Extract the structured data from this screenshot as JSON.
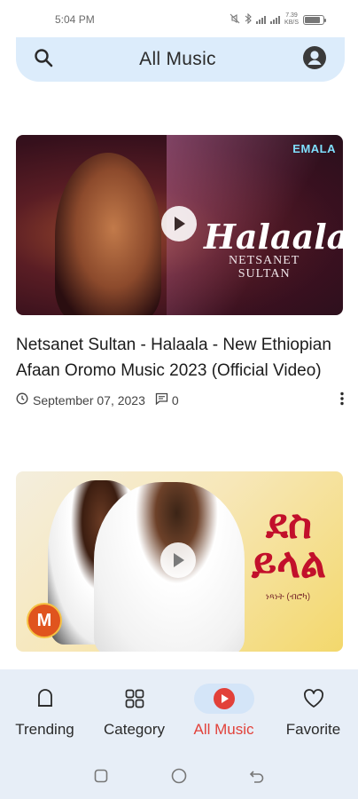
{
  "status": {
    "time": "5:04 PM",
    "speed_value": "7.39",
    "speed_unit": "KB/S",
    "battery_level": 0.9
  },
  "search": {
    "title": "All Music"
  },
  "videos": [
    {
      "overlay_title": "Halaala",
      "overlay_artist_line1": "NETSANET",
      "overlay_artist_line2": "SULTAN",
      "brand_logo": "EMALA",
      "title": "Netsanet Sultan - Halaala - New Ethiopian Afaan Oromo Music 2023 (Official Video)",
      "date": "September 07, 2023",
      "comments": "0"
    },
    {
      "overlay_title_line1": "ደስ",
      "overlay_title_line2": "ይላል",
      "overlay_subtitle": "ነጻነት (ብሮካ)",
      "channel_logo": "M"
    }
  ],
  "bottom_nav": {
    "items": [
      {
        "label": "Trending",
        "icon": "trending-icon"
      },
      {
        "label": "Category",
        "icon": "category-icon"
      },
      {
        "label": "All Music",
        "icon": "play-circle-icon"
      },
      {
        "label": "Favorite",
        "icon": "heart-icon"
      }
    ],
    "active_index": 2
  },
  "colors": {
    "accent": "#e2413a",
    "search_bg": "#dcecfb",
    "nav_bg": "#e7eef7",
    "active_pill": "#d4e5f8"
  }
}
